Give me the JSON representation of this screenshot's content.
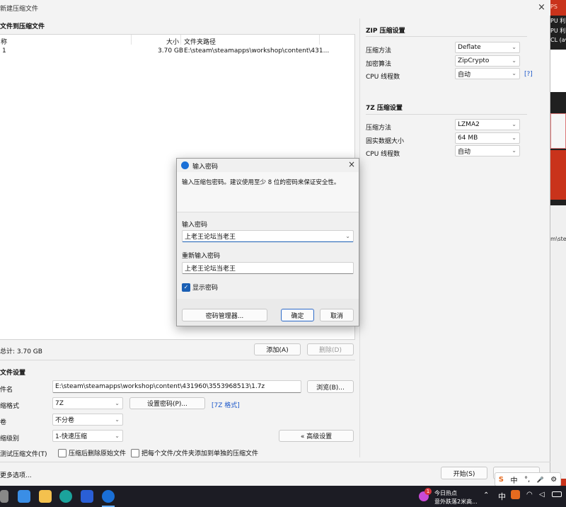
{
  "window": {
    "title": "新建压缩文件",
    "close_glyph": "×"
  },
  "files": {
    "section_title": "文件到压缩文件",
    "columns": {
      "name": "称",
      "size": "大小",
      "path": "文件夹路径"
    },
    "rows": [
      {
        "name": "1",
        "size": "3.70 GB",
        "path": "E:\\steam\\steamapps\\workshop\\content\\431..."
      }
    ],
    "total": "总计: 3.70 GB",
    "add_label": "添加(A)",
    "delete_label": "删除(D)"
  },
  "archive": {
    "section_title": "文件设置",
    "name_label": "件名",
    "name_value": "E:\\steam\\steamapps\\workshop\\content\\431960\\3553968513\\1.7z",
    "browse_label": "浏览(B)...",
    "format_label": "缩格式",
    "format_value": "7Z",
    "set_password_label": "设置密码(P)...",
    "format_link": "[7Z 格式]",
    "volume_label": "卷",
    "volume_value": "不分卷",
    "level_label": "缩级别",
    "level_value": "1-快速压缩",
    "advanced_label": "« 高级设置",
    "test_label": "测试压缩文件(T)",
    "delete_after_label": "压缩后删除原始文件",
    "separate_label": "把每个文件/文件夹添加到单独的压缩文件",
    "more_options": "更多选项...",
    "start_label": "开始(S)"
  },
  "zip": {
    "title": "ZIP 压缩设置",
    "method_label": "压缩方法",
    "method_value": "Deflate",
    "encrypt_label": "加密算法",
    "encrypt_value": "ZipCrypto",
    "cpu_label": "CPU 线程数",
    "cpu_value": "自动",
    "help": "[?]"
  },
  "sevenz": {
    "title": "7Z 压缩设置",
    "method_label": "压缩方法",
    "method_value": "LZMA2",
    "solid_label": "固实数据大小",
    "solid_value": "64 MB",
    "cpu_label": "CPU 线程数",
    "cpu_value": "自动"
  },
  "dialog": {
    "title": "输入密码",
    "message": "输入压缩包密码。建议使用至少 8 位的密码来保证安全性。",
    "password_label": "输入密码",
    "password_value": "上老王论坛当老王",
    "reenter_label": "重新输入密码",
    "reenter_value": "上老王论坛当老王",
    "show_password_label": "显示密码",
    "manager_label": "密码管理器...",
    "ok_label": "确定",
    "cancel_label": "取消"
  },
  "background_right": {
    "line1": "PS",
    "line2": "PU 利",
    "line3": "PU 利",
    "line4": "CL (av",
    "line5": "m\\ste"
  },
  "ime": {
    "s": "S",
    "lang": "中",
    "punct": "°,",
    "mic": "🎤",
    "gear": "⚙"
  },
  "taskbar": {
    "news_title": "今日热点",
    "news_sub": "意外跌落2米高...",
    "badge": "1",
    "ime_lang": "中"
  },
  "colors": {
    "accent": "#1a5fb4",
    "link": "#1a56c9",
    "brand_red": "#e53a1f"
  }
}
